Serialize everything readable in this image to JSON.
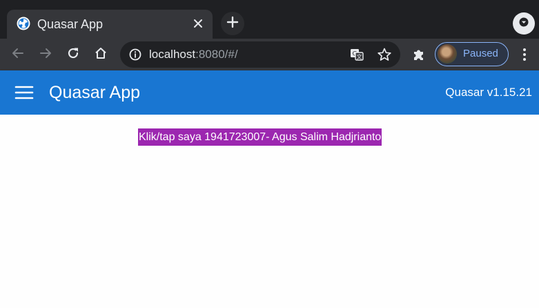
{
  "browser": {
    "tab": {
      "title": "Quasar App",
      "favicon": "quasar-logo-icon",
      "close_icon": "close-icon"
    },
    "new_tab_icon": "plus-icon",
    "tab_search_icon": "chevron-down-icon",
    "toolbar": {
      "back_icon": "arrow-left-icon",
      "forward_icon": "arrow-right-icon",
      "reload_icon": "reload-icon",
      "home_icon": "home-icon",
      "url_host": "localhost",
      "url_rest": ":8080/#/",
      "site_info_icon": "info-icon",
      "translate_icon": "translate-icon",
      "bookmark_icon": "star-icon",
      "extensions_icon": "puzzle-icon",
      "profile_label": "Paused",
      "menu_icon": "kebab-menu-icon"
    }
  },
  "app": {
    "header": {
      "menu_icon": "hamburger-icon",
      "title": "Quasar App",
      "version": "Quasar v1.15.21",
      "color": "#1976d2"
    },
    "main": {
      "button_label": "Klik/tap saya 1941723007- Agus Salim Hadjrianto",
      "button_color": "#9c27b0"
    }
  }
}
